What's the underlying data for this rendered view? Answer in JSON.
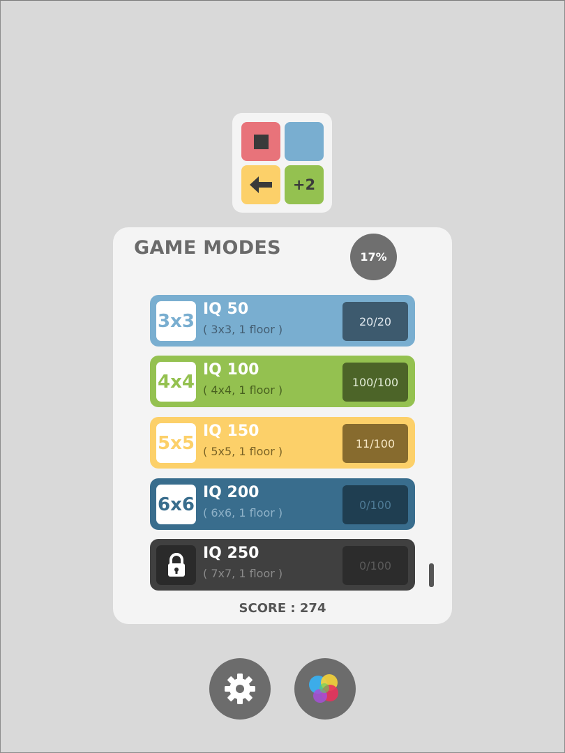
{
  "logo": {
    "plus_label": "+2"
  },
  "panel": {
    "title": "GAME MODES",
    "progress": "17%",
    "score_text": "SCORE : 274"
  },
  "modes": [
    {
      "size": "3x3",
      "iq": "IQ 50",
      "desc": "( 3x3, 1 floor )",
      "progress": "20/20",
      "locked": false,
      "color": "#79aed0",
      "box_color": "#3d5a6e",
      "text_color": "#e0e8ee",
      "sub_color": "#445e72"
    },
    {
      "size": "4x4",
      "iq": "IQ 100",
      "desc": "( 4x4, 1 floor )",
      "progress": "100/100",
      "locked": false,
      "color": "#94c150",
      "box_color": "#4c6428",
      "text_color": "#e2ecd6",
      "sub_color": "#48601f"
    },
    {
      "size": "5x5",
      "iq": "IQ 150",
      "desc": "( 5x5, 1 floor )",
      "progress": "11/100",
      "locked": false,
      "color": "#fcd069",
      "box_color": "#876b2e",
      "text_color": "#f6e7c4",
      "sub_color": "#7a6326"
    },
    {
      "size": "6x6",
      "iq": "IQ 200",
      "desc": "( 6x6, 1 floor )",
      "progress": "0/100",
      "locked": false,
      "color": "#396d8d",
      "box_color": "#1f3e51",
      "text_color": "#4e7a95",
      "sub_color": "#8fb2c8"
    },
    {
      "size": "",
      "iq": "IQ 250",
      "desc": "( 7x7, 1 floor )",
      "progress": "0/100",
      "locked": true,
      "color": "#404040",
      "box_color": "#2c2c2c",
      "text_color": "#5a5a5a",
      "sub_color": "#8a8a8a"
    }
  ],
  "icons": {
    "settings": "gear-icon",
    "game_center": "game-center-icon",
    "lock": "lock-icon"
  }
}
